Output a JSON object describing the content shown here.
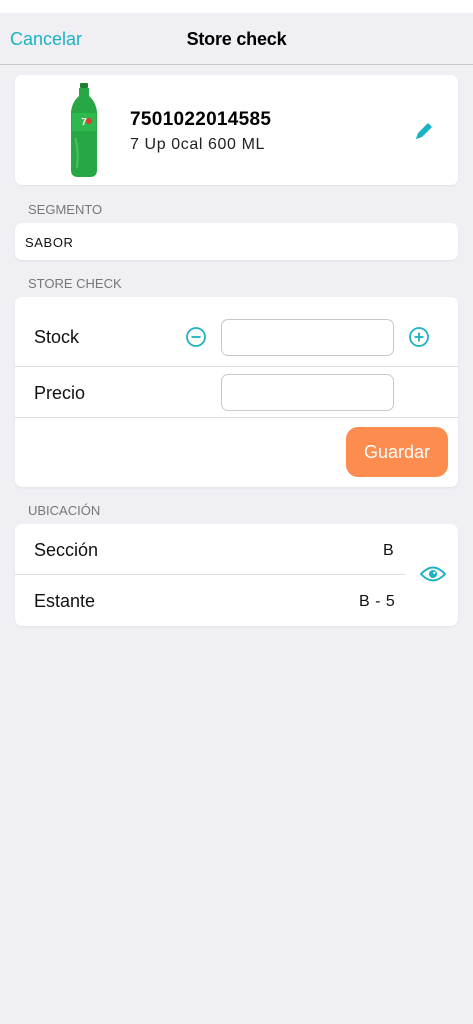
{
  "header": {
    "cancel_label": "Cancelar",
    "title": "Store check"
  },
  "product": {
    "code": "7501022014585",
    "name": "7 Up 0cal 600 ML",
    "image": "7up-bottle",
    "edit_icon": "pencil-icon"
  },
  "segment": {
    "section_label": "SEGMENTO",
    "value": "SABOR"
  },
  "store_check": {
    "section_label": "STORE CHECK",
    "stock_label": "Stock",
    "stock_value": "",
    "price_label": "Precio",
    "price_value": "",
    "decrement_icon": "minus-circle-icon",
    "increment_icon": "plus-circle-icon",
    "save_label": "Guardar"
  },
  "location": {
    "section_label": "UBICACIÓN",
    "section_row_label": "Sección",
    "section_row_value": "B",
    "shelf_label": "Estante",
    "shelf_value": "B - 5",
    "view_icon": "eye-icon"
  },
  "colors": {
    "accent": "#1bb3c3",
    "save_button": "#fd8c4f",
    "background": "#efeff4"
  }
}
